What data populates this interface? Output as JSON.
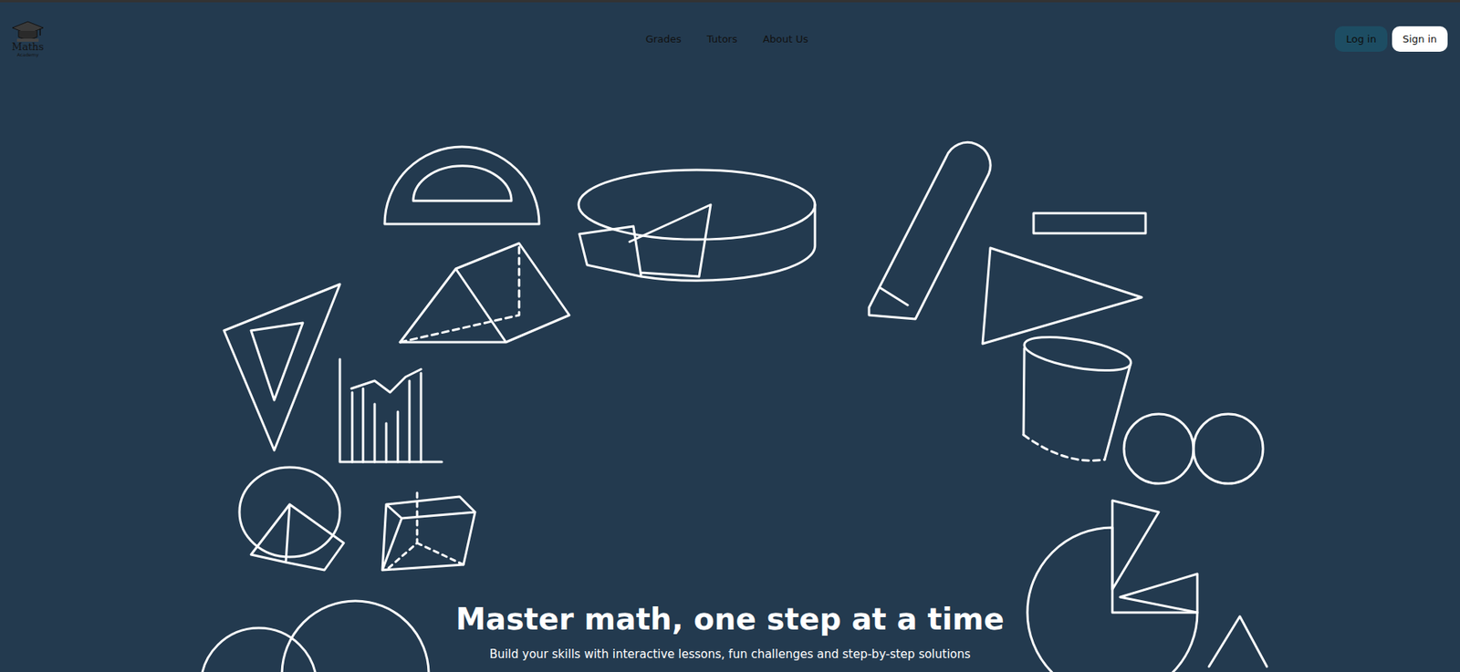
{
  "logo": {
    "title": "Maths",
    "subtitle": "Academy"
  },
  "nav": [
    {
      "label": "Grades"
    },
    {
      "label": "Tutors"
    },
    {
      "label": "About Us"
    }
  ],
  "auth_buttons": [
    "Log in",
    "Sign in"
  ],
  "hero": {
    "title": "Master math, one step at a time",
    "subtitle": "Build your skills with interactive lessons, fun challenges and step-by-step solutions"
  }
}
